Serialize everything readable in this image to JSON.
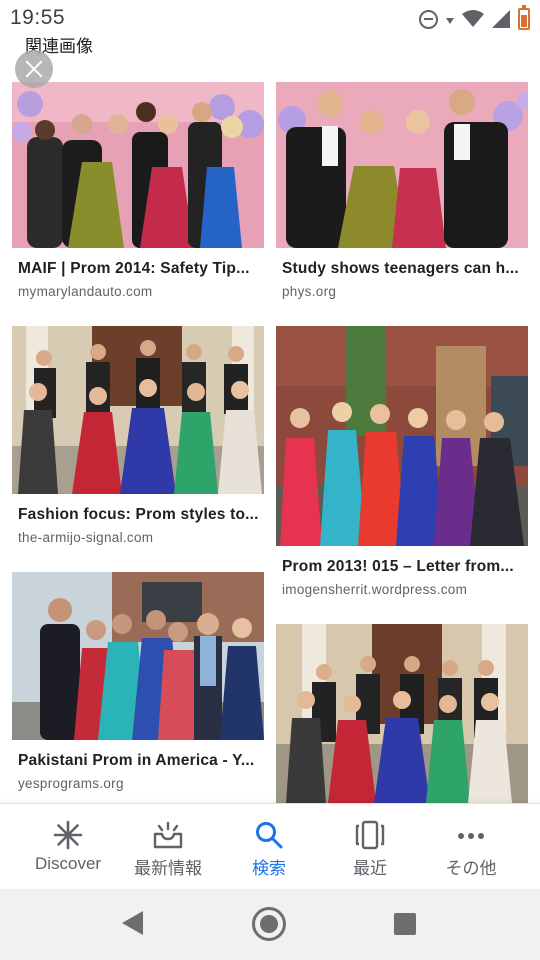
{
  "status_bar": {
    "time": "19:55",
    "icons": [
      "do-not-disturb-icon",
      "data-arrow-icon",
      "wifi-icon",
      "signal-icon",
      "battery-icon"
    ],
    "battery_color": "#d96f33"
  },
  "header": {
    "section_title": "関連画像",
    "close_icon": "close-icon"
  },
  "results": [
    {
      "title": "MAIF | Prom 2014: Safety Tip...",
      "source": "mymarylandauto.com",
      "image": "prom group on pink balloon backdrop"
    },
    {
      "title": "Study shows teenagers can h...",
      "source": "phys.org",
      "image": "prom couples on pink backdrop"
    },
    {
      "title": "Fashion focus: Prom styles to...",
      "source": "the-armijo-signal.com",
      "image": "prom group on steps"
    },
    {
      "title": "Prom 2013! 015 – Letter from...",
      "source": "imogensherrit.wordpress.com",
      "image": "girls in prom dresses outside brick house"
    },
    {
      "title": "Pakistani Prom in America - Y...",
      "source": "yesprograms.org",
      "image": "prom group outdoors"
    },
    {
      "title": "",
      "source": "",
      "image": "prom group posing on steps"
    }
  ],
  "bottom_nav": {
    "items": [
      {
        "label": "Discover",
        "icon": "asterisk-icon",
        "active": false
      },
      {
        "label": "最新情報",
        "icon": "updates-tray-icon",
        "active": false
      },
      {
        "label": "検索",
        "icon": "search-icon",
        "active": true
      },
      {
        "label": "最近",
        "icon": "recent-cards-icon",
        "active": false
      },
      {
        "label": "その他",
        "icon": "more-dots-icon",
        "active": false
      }
    ],
    "active_color": "#1a73e8",
    "inactive_color": "#5f6368"
  },
  "system_nav": {
    "buttons": [
      "back-icon",
      "home-icon",
      "recents-icon"
    ]
  }
}
